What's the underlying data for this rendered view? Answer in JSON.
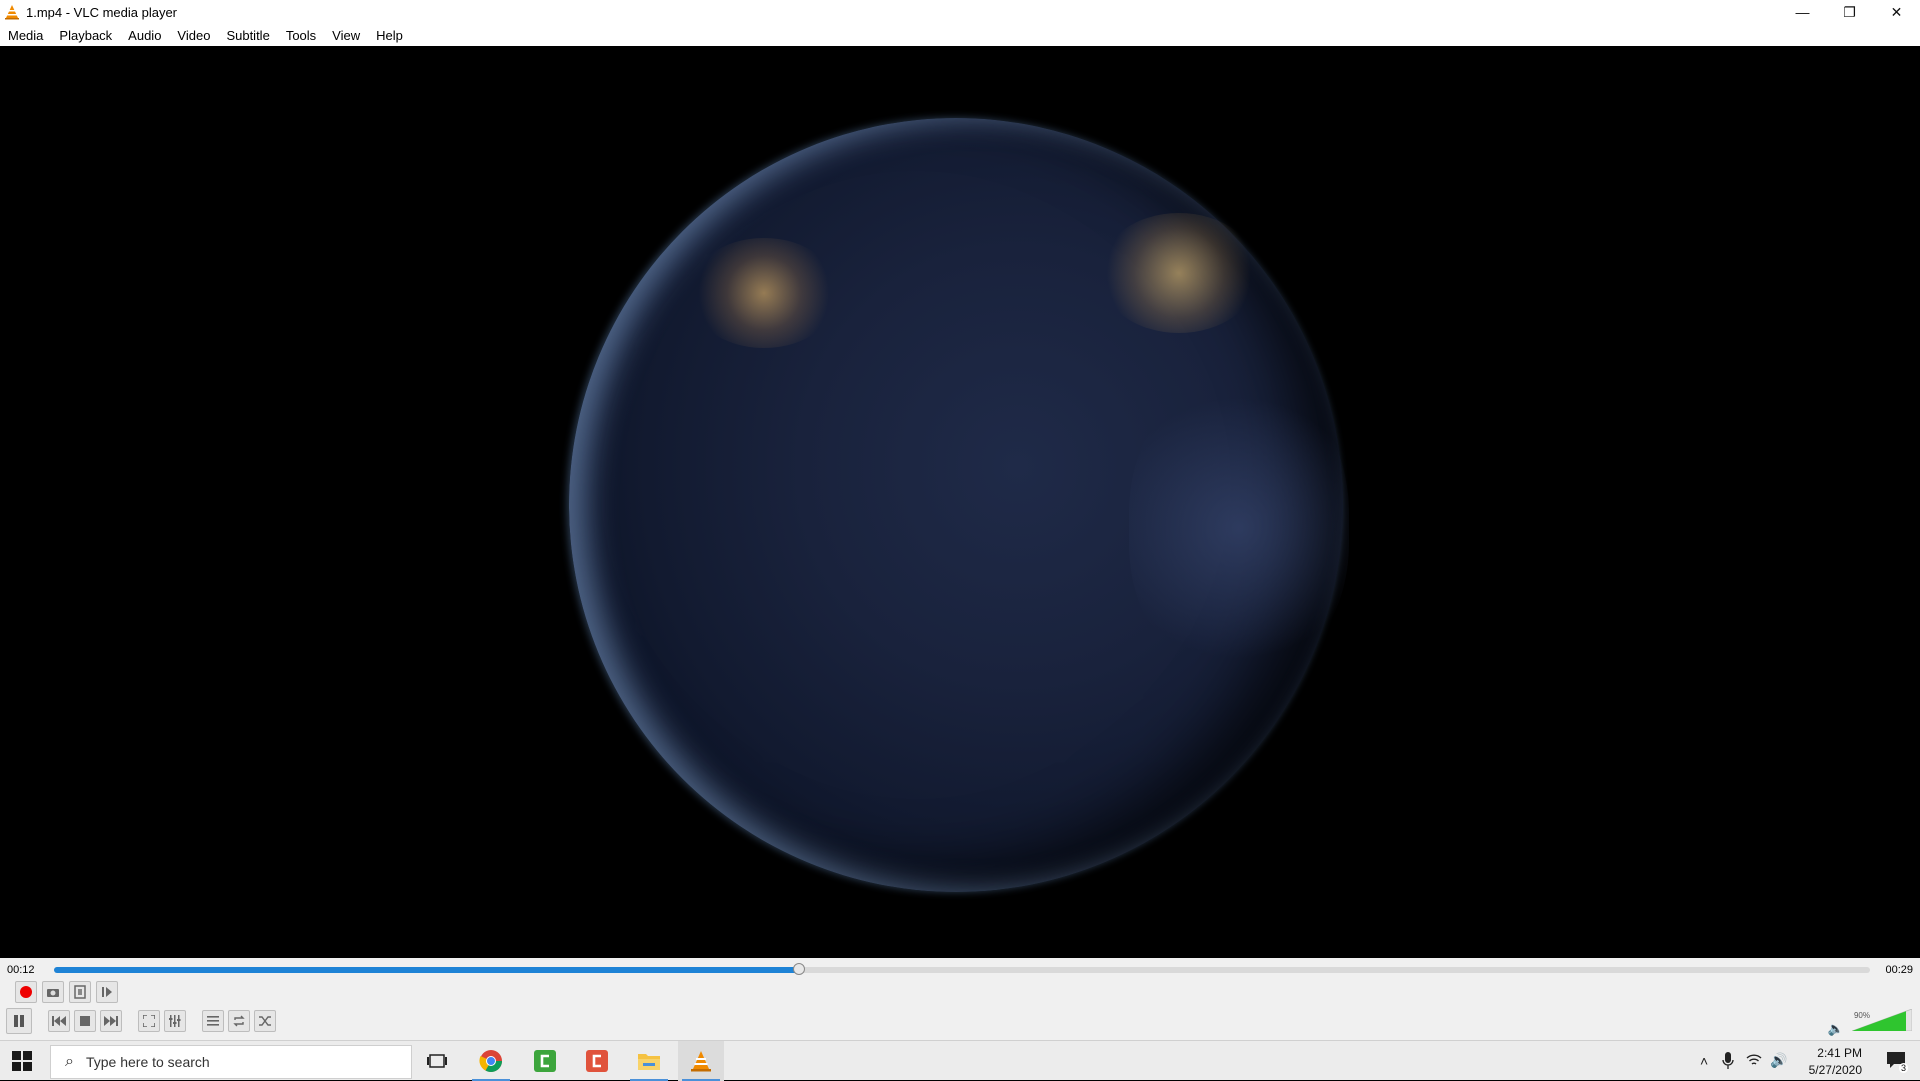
{
  "window": {
    "title": "1.mp4 - VLC media player",
    "controls": {
      "minimize": "—",
      "restore": "❐",
      "close": "✕"
    }
  },
  "menu": [
    "Media",
    "Playback",
    "Audio",
    "Video",
    "Subtitle",
    "Tools",
    "View",
    "Help"
  ],
  "player": {
    "elapsed": "00:12",
    "total": "00:29",
    "progress": 0.41,
    "volume_label": "90%",
    "volume": 0.9
  },
  "taskbar": {
    "search_placeholder": "Type here to search",
    "clock_time": "2:41 PM",
    "clock_date": "5/27/2020",
    "notification_count": "3"
  },
  "colors": {
    "accent": "#1e83d6",
    "vlc_orange": "#f08a00",
    "record_red": "#e00000"
  }
}
